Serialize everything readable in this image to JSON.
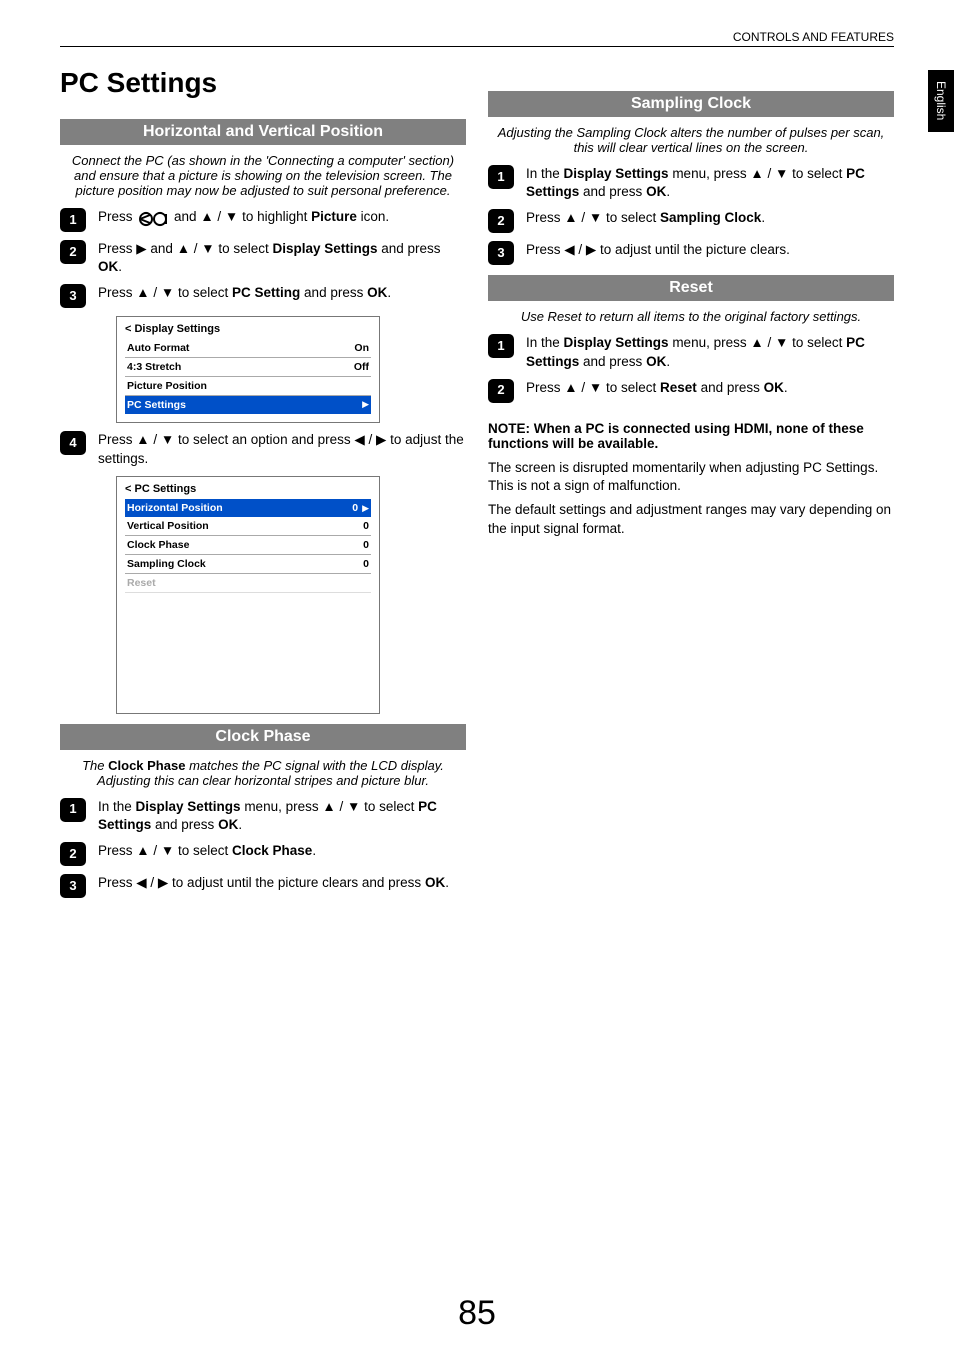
{
  "header": {
    "section": "CONTROLS AND FEATURES"
  },
  "side_tab": "English",
  "page_number": "85",
  "left": {
    "title": "PC Settings",
    "sections": {
      "hv": {
        "heading": "Horizontal and Vertical Position",
        "intro": "Connect the PC (as shown in the 'Connecting a computer' section) and ensure that a picture is showing on the television screen. The picture position may now be adjusted to suit personal preference.",
        "steps": {
          "s1_a": "Press ",
          "s1_b": " and ",
          "s1_c": " to highlight ",
          "s1_d": "Picture",
          "s1_e": " icon.",
          "s2_a": "Press ",
          "s2_b": " and ",
          "s2_c": " to select ",
          "s2_d": "Display Settings",
          "s2_e": " and press ",
          "s2_f": "OK",
          "s2_g": ".",
          "s3_a": "Press ",
          "s3_b": " to select ",
          "s3_c": "PC Setting",
          "s3_d": " and press ",
          "s3_e": "OK",
          "s3_f": ".",
          "s4_a": "Press ",
          "s4_b": " to select an option and press ",
          "s4_c": " to adjust the settings."
        },
        "menu1": {
          "title": "< Display Settings",
          "rows": [
            {
              "label": "Auto Format",
              "value": "On"
            },
            {
              "label": "4:3 Stretch",
              "value": "Off"
            },
            {
              "label": "Picture Position",
              "value": ""
            },
            {
              "label": "PC Settings",
              "value": "",
              "selected": true,
              "arrow": true
            }
          ]
        },
        "menu2": {
          "title": "< PC Settings",
          "rows": [
            {
              "label": "Horizontal Position",
              "value": "0",
              "selected": true,
              "arrow": true
            },
            {
              "label": "Vertical Position",
              "value": "0"
            },
            {
              "label": "Clock Phase",
              "value": "0"
            },
            {
              "label": "Sampling Clock",
              "value": "0"
            },
            {
              "label": "Reset",
              "value": "",
              "dim": true
            }
          ]
        }
      },
      "clock_phase": {
        "heading": "Clock Phase",
        "intro_a": "The ",
        "intro_b": "Clock Phase",
        "intro_c": " matches the PC signal with the LCD display. Adjusting this can clear horizontal stripes and picture blur.",
        "steps": {
          "s1_a": "In the ",
          "s1_b": "Display Settings",
          "s1_c": " menu, press ",
          "s1_d": " to select ",
          "s1_e": "PC Settings",
          "s1_f": " and press ",
          "s1_g": "OK",
          "s1_h": ".",
          "s2_a": "Press ",
          "s2_b": " to select ",
          "s2_c": "Clock Phase",
          "s2_d": ".",
          "s3_a": "Press ",
          "s3_b": " to adjust until the picture clears and press ",
          "s3_c": "OK",
          "s3_d": "."
        }
      }
    }
  },
  "right": {
    "sampling": {
      "heading": "Sampling Clock",
      "intro": "Adjusting the Sampling Clock alters the number of pulses per scan, this will clear vertical lines on the screen.",
      "steps": {
        "s1_a": "In the ",
        "s1_b": "Display Settings",
        "s1_c": " menu, press ",
        "s1_d": " to select ",
        "s1_e": "PC Settings",
        "s1_f": " and press ",
        "s1_g": "OK",
        "s1_h": ".",
        "s2_a": "Press ",
        "s2_b": " to select ",
        "s2_c": "Sampling Clock",
        "s2_d": ".",
        "s3_a": "Press ",
        "s3_b": " to adjust until the picture clears."
      }
    },
    "reset": {
      "heading": "Reset",
      "intro": "Use Reset to return all items to the original factory settings.",
      "steps": {
        "s1_a": "In the ",
        "s1_b": "Display Settings",
        "s1_c": " menu, press ",
        "s1_d": " to select ",
        "s1_e": "PC Settings",
        "s1_f": " and press ",
        "s1_g": "OK",
        "s1_h": ".",
        "s2_a": "Press ",
        "s2_b": " to select ",
        "s2_c": "Reset",
        "s2_d": " and press ",
        "s2_e": "OK",
        "s2_f": "."
      }
    },
    "note": "NOTE: When a PC is connected using HDMI, none of these functions will be available.",
    "body1": "The screen is disrupted momentarily when adjusting PC Settings. This is not a sign of malfunction.",
    "body2": "The default settings and adjustment ranges may vary depending on the input signal format."
  }
}
